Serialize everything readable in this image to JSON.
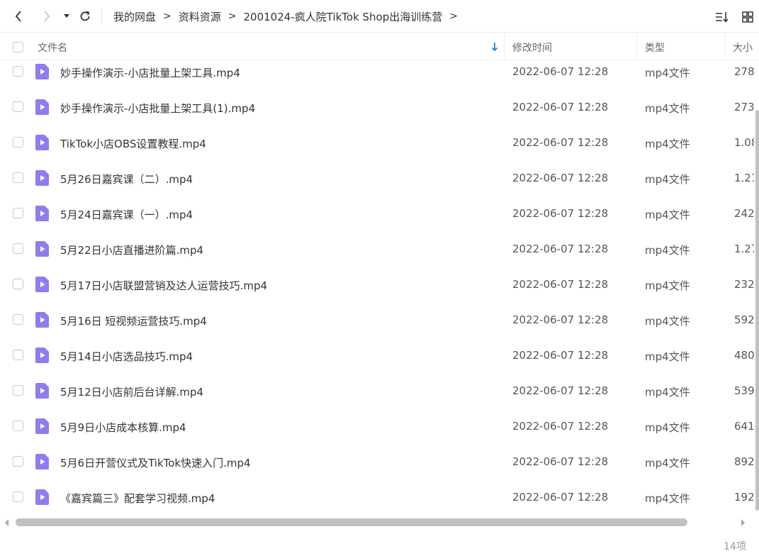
{
  "toolbar": {
    "back_icon": "chevron-left",
    "forward_icon": "chevron-right",
    "history_dropdown_icon": "caret-down",
    "refresh_icon": "refresh",
    "sort_icon": "sort-list",
    "view_icon": "grid-view"
  },
  "breadcrumb": {
    "items": [
      "我的网盘",
      "资料资源",
      "2001024-疯人院TikTok Shop出海训练营"
    ],
    "separator": ">"
  },
  "table": {
    "columns": [
      "文件名",
      "修改时间",
      "类型",
      "大小"
    ],
    "rows": [
      {
        "name": "妙手操作演示-小店批量上架工具.mp4",
        "modified": "2022-06-07 12:28",
        "type": "mp4文件",
        "size": "278"
      },
      {
        "name": "妙手操作演示-小店批量上架工具(1).mp4",
        "modified": "2022-06-07 12:28",
        "type": "mp4文件",
        "size": "273"
      },
      {
        "name": "TikTok小店OBS设置教程.mp4",
        "modified": "2022-06-07 12:28",
        "type": "mp4文件",
        "size": "1.08"
      },
      {
        "name": "5月26日嘉宾课（二）.mp4",
        "modified": "2022-06-07 12:28",
        "type": "mp4文件",
        "size": "1.21"
      },
      {
        "name": "5月24日嘉宾课（一）.mp4",
        "modified": "2022-06-07 12:28",
        "type": "mp4文件",
        "size": "242"
      },
      {
        "name": "5月22日小店直播进阶篇.mp4",
        "modified": "2022-06-07 12:28",
        "type": "mp4文件",
        "size": "1.27"
      },
      {
        "name": "5月17日小店联盟营销及达人运营技巧.mp4",
        "modified": "2022-06-07 12:28",
        "type": "mp4文件",
        "size": "232"
      },
      {
        "name": "5月16日 短视频运营技巧.mp4",
        "modified": "2022-06-07 12:28",
        "type": "mp4文件",
        "size": "592"
      },
      {
        "name": "5月14日小店选品技巧.mp4",
        "modified": "2022-06-07 12:28",
        "type": "mp4文件",
        "size": "480"
      },
      {
        "name": "5月12日小店前后台详解.mp4",
        "modified": "2022-06-07 12:28",
        "type": "mp4文件",
        "size": "539"
      },
      {
        "name": "5月9日小店成本核算.mp4",
        "modified": "2022-06-07 12:28",
        "type": "mp4文件",
        "size": "641"
      },
      {
        "name": "5月6日开营仪式及TikTok快速入门.mp4",
        "modified": "2022-06-07 12:28",
        "type": "mp4文件",
        "size": "892"
      },
      {
        "name": "《嘉宾篇三》配套学习视频.mp4",
        "modified": "2022-06-07 12:28",
        "type": "mp4文件",
        "size": "192"
      }
    ]
  },
  "colors": {
    "video_icon": "#8f7cf0",
    "sort_arrow": "#1e88e5",
    "scrollbar": "#c1c1c1"
  },
  "footer": {
    "count": "14项"
  }
}
